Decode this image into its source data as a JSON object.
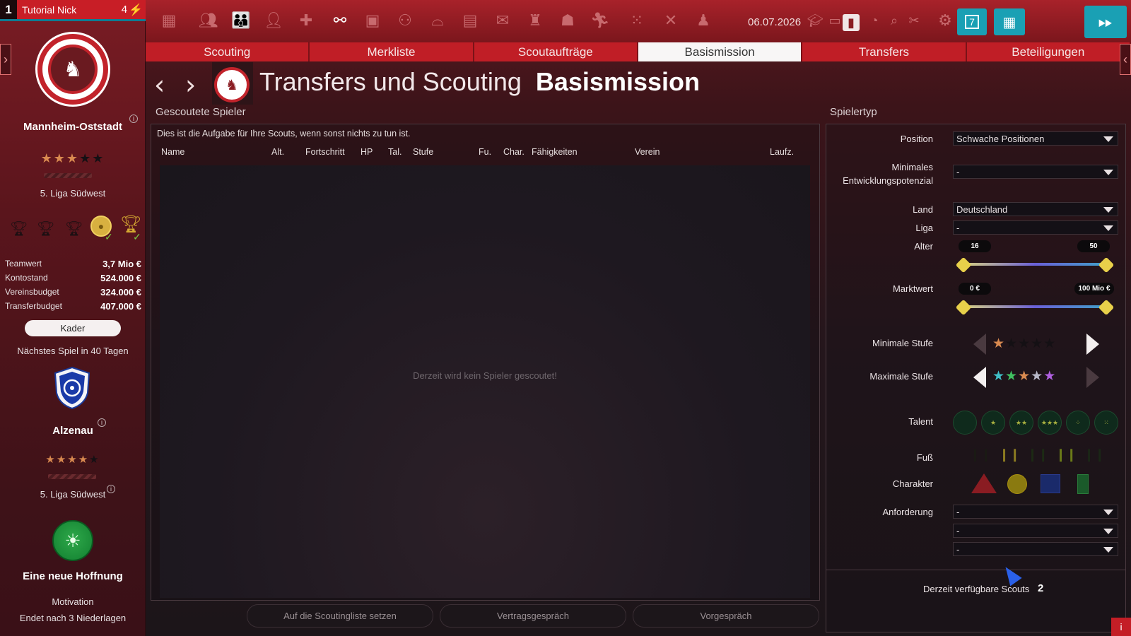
{
  "user": {
    "slot": "1",
    "name": "Tutorial Nick",
    "points": "4"
  },
  "club": {
    "name": "Mannheim-Oststadt",
    "stars": 3,
    "max_stars": 5,
    "league": "5. Liga Südwest"
  },
  "finances": [
    {
      "label": "Teamwert",
      "value": "3,7 Mio €"
    },
    {
      "label": "Kontostand",
      "value": "524.000 €"
    },
    {
      "label": "Vereinsbudget",
      "value": "324.000 €"
    },
    {
      "label": "Transferbudget",
      "value": "407.000 €"
    }
  ],
  "kader_label": "Kader",
  "next_game": "Nächstes Spiel in 40 Tagen",
  "opponent": {
    "name": "Alzenau",
    "stars": 4,
    "max_stars": 5,
    "league": "5. Liga Südwest"
  },
  "mood": {
    "title": "Eine neue Hoffnung",
    "label": "Motivation",
    "detail": "Endet nach 3 Niederlagen"
  },
  "topbar": {
    "date": "06.07.2026",
    "icons": [
      "tactics-board-icon",
      "squad-icon",
      "team-icon",
      "staff-icon",
      "medical-icon",
      "scouting-binoculars-icon",
      "calendar-icon",
      "training-icon",
      "stadium-icon",
      "finances-icon",
      "sponsors-icon",
      "jersey-icon",
      "youth-icon",
      "fitness-icon",
      "formation-icon",
      "tactics-icon",
      "profile-icon"
    ],
    "calendar_day": "7"
  },
  "tabs": [
    "Scouting",
    "Merkliste",
    "Scoutaufträge",
    "Basismission",
    "Transfers",
    "Beteiligungen"
  ],
  "active_tab": 3,
  "header": {
    "title": "Transfers und Scouting",
    "subtitle": "Basismission"
  },
  "left_panel": {
    "title": "Gescoutete Spieler",
    "description": "Dies ist die Aufgabe für Ihre Scouts, wenn sonst nichts zu tun ist.",
    "columns": [
      "Name",
      "Alt.",
      "Fortschritt",
      "HP",
      "Tal.",
      "Stufe",
      "Fu.",
      "Char.",
      "Fähigkeiten",
      "Verein",
      "Laufz."
    ],
    "empty_text": "Derzeit wird kein Spieler gescoutet!"
  },
  "buttons": {
    "scoutlist": "Auf die Scoutingliste setzen",
    "contract": "Vertragsgespräch",
    "pretalk": "Vorgespräch"
  },
  "right_panel": {
    "title": "Spielertyp",
    "position_label": "Position",
    "position_value": "Schwache Positionen",
    "dev_label_1": "Minimales",
    "dev_label_2": "Entwicklungspotenzial",
    "dev_value": "-",
    "land_label": "Land",
    "land_value": "Deutschland",
    "liga_label": "Liga",
    "liga_value": "-",
    "alter_label": "Alter",
    "alter_min": "16",
    "alter_max": "50",
    "marktwert_label": "Marktwert",
    "marktwert_min": "0 €",
    "marktwert_max": "100 Mio €",
    "min_stufe_label": "Minimale Stufe",
    "min_stufe_stars": 1,
    "max_stufe_label": "Maximale Stufe",
    "max_stufe_stars": 5,
    "talent_label": "Talent",
    "fuss_label": "Fuß",
    "charakter_label": "Charakter",
    "anforderung_label": "Anforderung",
    "anforderung_values": [
      "-",
      "-",
      "-"
    ],
    "scouts_label": "Derzeit verfügbare Scouts",
    "scouts_count": "2"
  },
  "colors": {
    "accent_red": "#c01e26",
    "teal": "#1aa0b4",
    "star_orange": "#d98a50"
  }
}
